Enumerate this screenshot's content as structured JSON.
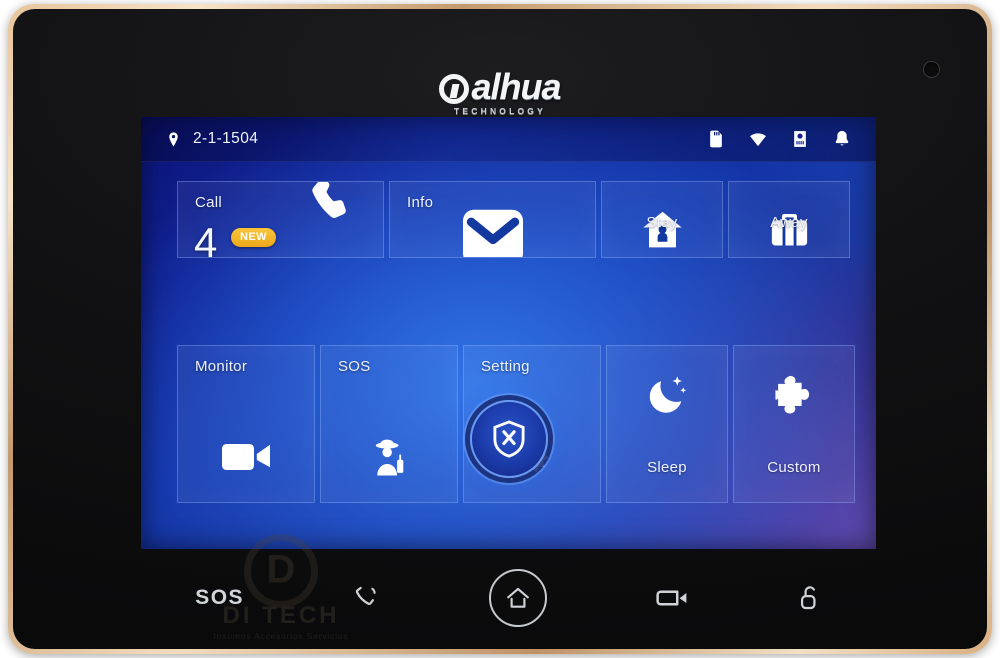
{
  "device": {
    "brand": "alhua",
    "brand_sub": "TECHNOLOGY",
    "sensor_name": "camera-sensor"
  },
  "screen": {
    "statusbar": {
      "location_icon": "location-pin-icon",
      "location": "2-1-1504",
      "icons": [
        {
          "name": "sd-card-icon",
          "label": "SD Card"
        },
        {
          "name": "wifi-icon",
          "label": "Wi-Fi"
        },
        {
          "name": "door-station-icon",
          "label": "Door Station"
        },
        {
          "name": "bell-icon",
          "label": "Ringer"
        }
      ]
    },
    "tiles_row1": [
      {
        "name": "tile-call",
        "label": "Call",
        "count": "4",
        "badge": "NEW",
        "icon": "phone-handset-icon"
      },
      {
        "name": "tile-info",
        "label": "Info",
        "icon": "envelope-icon"
      },
      {
        "name": "tile-stay",
        "label": "Stay",
        "icon": "house-person-icon"
      },
      {
        "name": "tile-away",
        "label": "Away",
        "icon": "suitcase-icon"
      }
    ],
    "tiles_row2": [
      {
        "name": "tile-monitor",
        "label": "Monitor",
        "icon": "video-camera-icon"
      },
      {
        "name": "tile-sos",
        "label": "SOS",
        "icon": "security-guard-icon"
      },
      {
        "name": "tile-setting",
        "label": "Setting",
        "icon": "gear-icon"
      },
      {
        "name": "tile-sleep",
        "label": "Sleep",
        "icon": "crescent-moon-icon"
      },
      {
        "name": "tile-custom",
        "label": "Custom",
        "icon": "puzzle-piece-icon"
      }
    ],
    "arm_button": {
      "name": "disarm-shield-button",
      "icon": "shield-x-icon"
    },
    "colors": {
      "badge": "#efb11f",
      "tile_border": "#96b9ff",
      "screen_blue": "#123ab0",
      "screen_purple": "#5a4a9e",
      "screen_navy": "#0a1172",
      "icon_white": "#ffffff",
      "bezel_black": "#121214",
      "trim_gold": "#d9ae7e"
    }
  },
  "watermark": {
    "logo_letter": "D",
    "name": "DI TECH",
    "tagline": "Insumos  Accesorios  Servicios"
  },
  "hardware_keys": [
    {
      "name": "key-sos",
      "label": "SOS",
      "icon": "sos-text"
    },
    {
      "name": "key-call",
      "label": "Call",
      "icon": "phone-ring-icon"
    },
    {
      "name": "key-home",
      "label": "Home",
      "icon": "home-icon"
    },
    {
      "name": "key-monitor",
      "label": "Monitor",
      "icon": "camera-monitor-icon"
    },
    {
      "name": "key-unlock",
      "label": "Unlock",
      "icon": "unlock-padlock-icon"
    }
  ]
}
